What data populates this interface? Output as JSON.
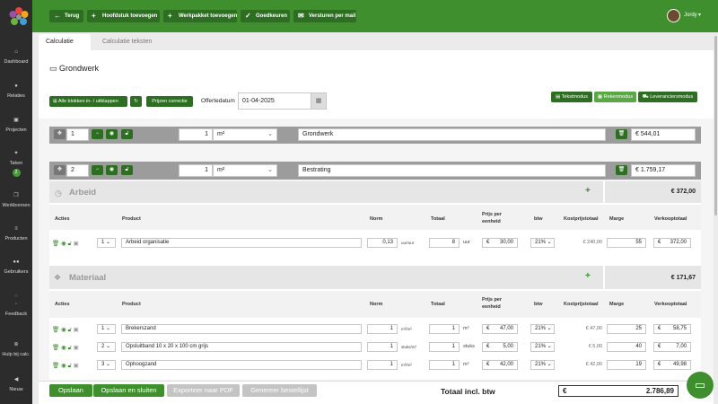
{
  "sidebar": {
    "items": [
      {
        "label": "Dashboard",
        "icon": "home-icon"
      },
      {
        "label": "Relaties",
        "icon": "user-icon"
      },
      {
        "label": "Projecten",
        "icon": "briefcase-icon"
      },
      {
        "label": "Taken",
        "icon": "pin-icon",
        "badge": "2"
      },
      {
        "label": "Werkbonnen",
        "icon": "copy-icon"
      },
      {
        "label": "Producten",
        "icon": "list-icon"
      },
      {
        "label": "Gebruikers",
        "icon": "users-icon"
      },
      {
        "label": "Feedback",
        "icon": "chat-icon"
      },
      {
        "label": "Hulp bij calc.",
        "icon": "help-icon"
      },
      {
        "label": "Nieuw",
        "icon": "megaphone-icon"
      }
    ]
  },
  "toolbar": {
    "back": "Terug",
    "add_chapter": "Hoofdstuk toevoegen",
    "add_package": "Werkpakket toevoegen",
    "approve": "Goedkeuren",
    "send_mail": "Versturen per mail",
    "user": "Jordy"
  },
  "tabs": [
    "Calculatie",
    "Calculatie teksten"
  ],
  "page": {
    "title": "Grondwerk",
    "toggle_blocks": "Alle blokken in- / uitklappen",
    "price_correction": "Prijzen correctie",
    "quote_date_label": "Offertedatum",
    "quote_date": "01-04-2025",
    "modes": [
      "Tekstmodus",
      "Rekenmodus",
      "Leveranciersmodus"
    ]
  },
  "chapter": {
    "number": "1",
    "qty": "1",
    "unit": "m²",
    "name": "Grondwerk",
    "currency": "€",
    "total": "544,01"
  },
  "package": {
    "number": "2",
    "qty": "1",
    "unit": "m²",
    "name": "Bestrating",
    "currency": "€",
    "total": "1.759,17"
  },
  "arbeid": {
    "title": "Arbeid",
    "total": "€ 372,00",
    "headers": {
      "acties": "Acties",
      "product": "Product",
      "norm": "Norm",
      "totaal": "Totaal",
      "prijs": "Prijs per eenheid",
      "btw": "btw",
      "kostprijs": "Kostprijstotaal",
      "marge": "Marge",
      "verkoop": "Verkooptotaal"
    },
    "rows": [
      {
        "pos": "1",
        "product": "Arbeid organisatie",
        "norm": "0,13",
        "norm_unit": "uur/uur",
        "totaal": "8",
        "totaal_unit": "uur",
        "prijs": "30,00",
        "btw": "21%",
        "kostprijs": "€ 240,00",
        "marge": "55",
        "verkoop": "372,00"
      }
    ]
  },
  "materiaal": {
    "title": "Materiaal",
    "total": "€ 171,67",
    "headers": {
      "acties": "Acties",
      "product": "Product",
      "norm": "Norm",
      "totaal": "Totaal",
      "prijs": "Prijs per eenheid",
      "btw": "btw",
      "kostprijs": "Kostprijstotaal",
      "marge": "Marge",
      "verkoop": "Verkooptotaal"
    },
    "rows": [
      {
        "pos": "1",
        "product": "Brekerszand",
        "norm": "1",
        "norm_unit": "m³/m²",
        "totaal": "1",
        "totaal_unit": "m³",
        "prijs": "47,00",
        "btw": "21%",
        "kostprijs": "€ 47,00",
        "marge": "25",
        "verkoop": "58,75"
      },
      {
        "pos": "2",
        "product": "Opsluitband 10 x 20 x 100 cm grijs",
        "norm": "1",
        "norm_unit": "stuks/m²",
        "totaal": "1",
        "totaal_unit": "stuks",
        "prijs": "5,00",
        "btw": "21%",
        "kostprijs": "€ 5,00",
        "marge": "40",
        "verkoop": "7,00"
      },
      {
        "pos": "3",
        "product": "Ophoogzand",
        "norm": "1",
        "norm_unit": "m³/m²",
        "totaal": "1",
        "totaal_unit": "m³",
        "prijs": "42,00",
        "btw": "21%",
        "kostprijs": "€ 42,00",
        "marge": "19",
        "verkoop": "49,98"
      }
    ]
  },
  "footer": {
    "save": "Opslaan",
    "save_close": "Opslaan en sluiten",
    "export_pdf": "Exporteer naar PDF",
    "order_list": "Genereer bestellijst",
    "total_label": "Totaal incl. btw",
    "currency": "€",
    "total": "2.786,89"
  },
  "colors": {
    "primary": "#3f8f2f",
    "dark_green": "#2e6e22",
    "sidebar": "#2c2c2c"
  }
}
